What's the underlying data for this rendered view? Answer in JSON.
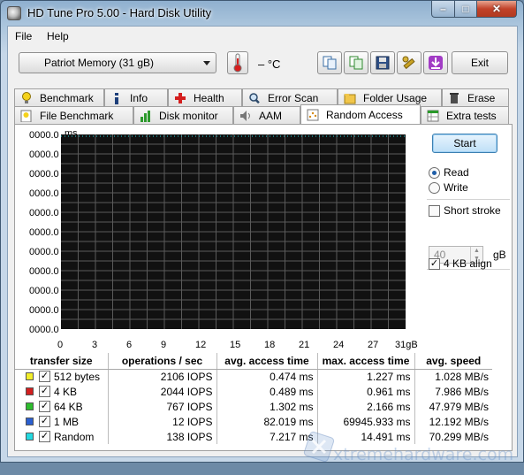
{
  "window": {
    "title": "HD Tune Pro 5.00 - Hard Disk Utility"
  },
  "menu": {
    "file": "File",
    "help": "Help"
  },
  "toolbar": {
    "drive": "Patriot Memory   (31 gB)",
    "temperature": "– °C",
    "exit_label": "Exit"
  },
  "tabs_top": [
    "Benchmark",
    "Info",
    "Health",
    "Error Scan",
    "Folder Usage",
    "Erase"
  ],
  "tabs_bottom": [
    "File Benchmark",
    "Disk monitor",
    "AAM",
    "Random Access",
    "Extra tests"
  ],
  "active_tab": "Random Access",
  "chart": {
    "unit_label": "ms",
    "y_ticks": [
      "0000.0",
      "0000.0",
      "0000.0",
      "0000.0",
      "0000.0",
      "0000.0",
      "0000.0",
      "0000.0",
      "0000.0",
      "0000.0",
      "0000.0"
    ],
    "x_ticks": [
      "0",
      "3",
      "6",
      "9",
      "12",
      "15",
      "18",
      "21",
      "24",
      "27",
      "31gB"
    ],
    "background": "#111111",
    "grid_color": "#5a5a5a"
  },
  "controls": {
    "start_label": "Start",
    "read_label": "Read",
    "write_label": "Write",
    "read_selected": true,
    "short_stroke_label": "Short stroke",
    "short_stroke_checked": false,
    "short_stroke_value": "40",
    "short_stroke_unit": "gB",
    "align_label": "4 KB align",
    "align_checked": true
  },
  "results": {
    "headers": [
      "transfer size",
      "operations / sec",
      "avg. access time",
      "max. access time",
      "avg. speed"
    ],
    "rows": [
      {
        "color": "#f2ee2a",
        "size": "512 bytes",
        "ops": "2106 IOPS",
        "avg": "0.474 ms",
        "max": "1.227 ms",
        "speed": "1.028 MB/s"
      },
      {
        "color": "#d21f1f",
        "size": "4 KB",
        "ops": "2044 IOPS",
        "avg": "0.489 ms",
        "max": "0.961 ms",
        "speed": "7.986 MB/s"
      },
      {
        "color": "#2ebd2e",
        "size": "64 KB",
        "ops": "767 IOPS",
        "avg": "1.302 ms",
        "max": "2.166 ms",
        "speed": "47.979 MB/s"
      },
      {
        "color": "#2a5fd0",
        "size": "1 MB",
        "ops": "12 IOPS",
        "avg": "82.019 ms",
        "max": "69945.933 ms",
        "speed": "12.192 MB/s"
      },
      {
        "color": "#23d9e0",
        "size": "Random",
        "ops": "138 IOPS",
        "avg": "7.217 ms",
        "max": "14.491 ms",
        "speed": "70.299 MB/s"
      }
    ]
  },
  "watermark": "xtremehardware.com"
}
